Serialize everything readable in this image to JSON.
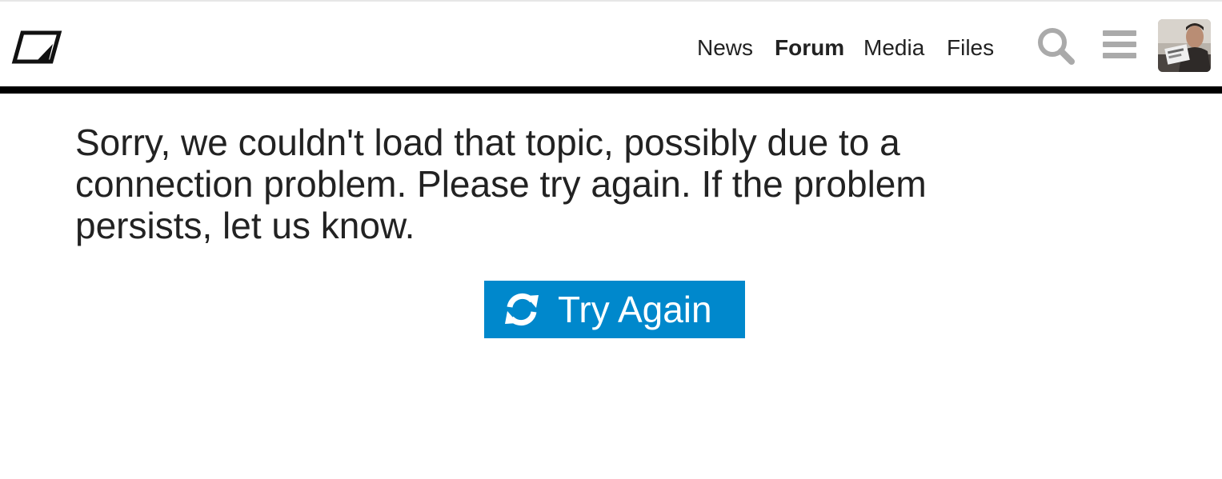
{
  "header": {
    "logo_icon": "site-logo-icon",
    "nav": [
      {
        "label": "News",
        "active": false
      },
      {
        "label": "Forum",
        "active": true
      },
      {
        "label": "Media",
        "active": false
      },
      {
        "label": "Files",
        "active": false
      }
    ],
    "search_icon": "search-icon",
    "menu_icon": "hamburger-menu-icon",
    "avatar_icon": "user-avatar"
  },
  "main": {
    "error_message": "Sorry, we couldn't load that topic, possibly due to a connection problem. Please try again. If the problem persists, let us know.",
    "retry_button": {
      "label": "Try Again",
      "icon": "refresh-icon"
    }
  },
  "colors": {
    "accent": "#0088cc",
    "header_rule": "#000000",
    "text": "#222222",
    "icon_gray": "#aaaaaa"
  }
}
